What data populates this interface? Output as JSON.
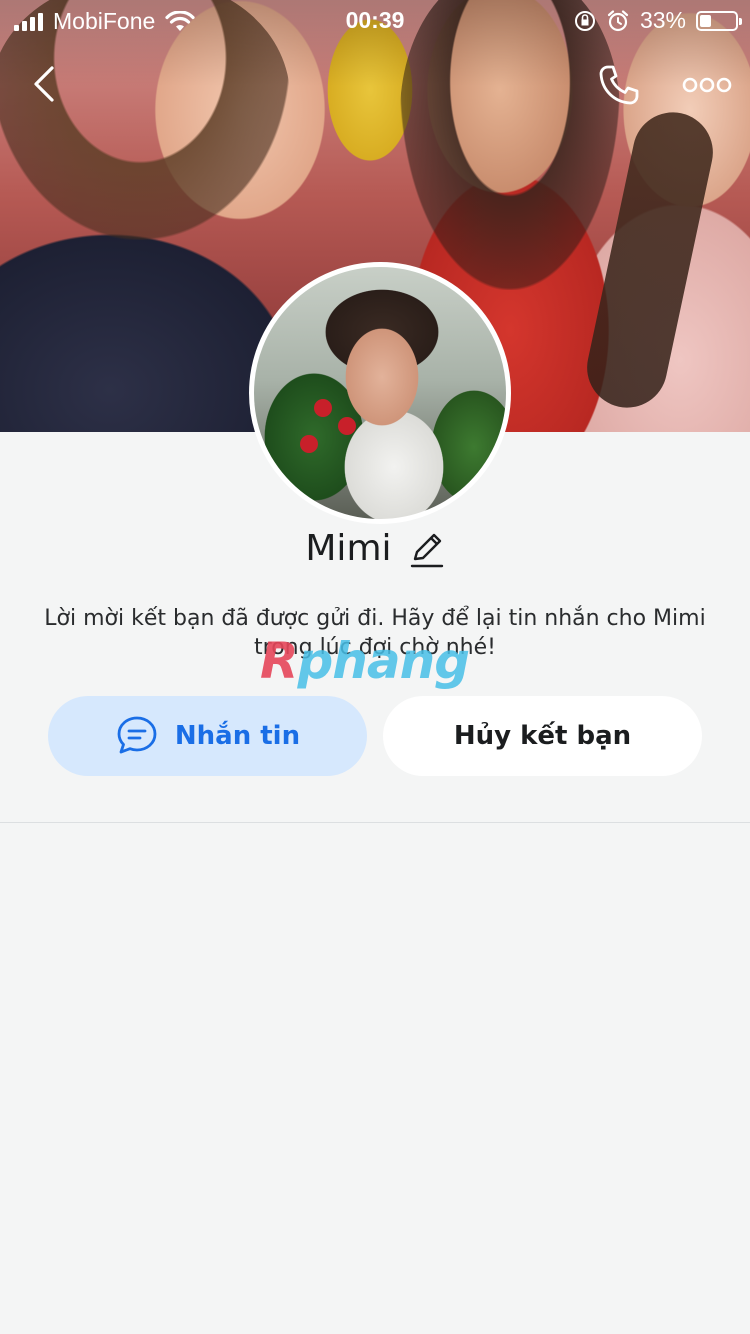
{
  "status_bar": {
    "carrier": "MobiFone",
    "time": "00:39",
    "battery_percent": "33%",
    "battery_level": 0.33,
    "icons": [
      "signal-icon",
      "wifi-icon",
      "rotation-lock-icon",
      "alarm-icon",
      "battery-icon"
    ]
  },
  "nav": {
    "back_icon": "chevron-left-icon",
    "call_icon": "phone-icon",
    "more_icon": "more-dots-icon"
  },
  "profile": {
    "name": "Mimi",
    "edit_icon": "pencil-icon"
  },
  "message": "Lời mời kết bạn đã được gửi đi. Hãy để lại tin nhắn cho Mimi trong lúc đợi chờ nhé!",
  "watermark": {
    "prefix": "R",
    "rest": "phang"
  },
  "actions": {
    "message_button": "Nhắn tin",
    "message_icon": "chat-bubble-icon",
    "cancel_button": "Hủy kết bạn"
  },
  "colors": {
    "accent": "#1a6ee6",
    "accent_bg": "#d6e8fd",
    "page_bg": "#f4f5f5"
  }
}
